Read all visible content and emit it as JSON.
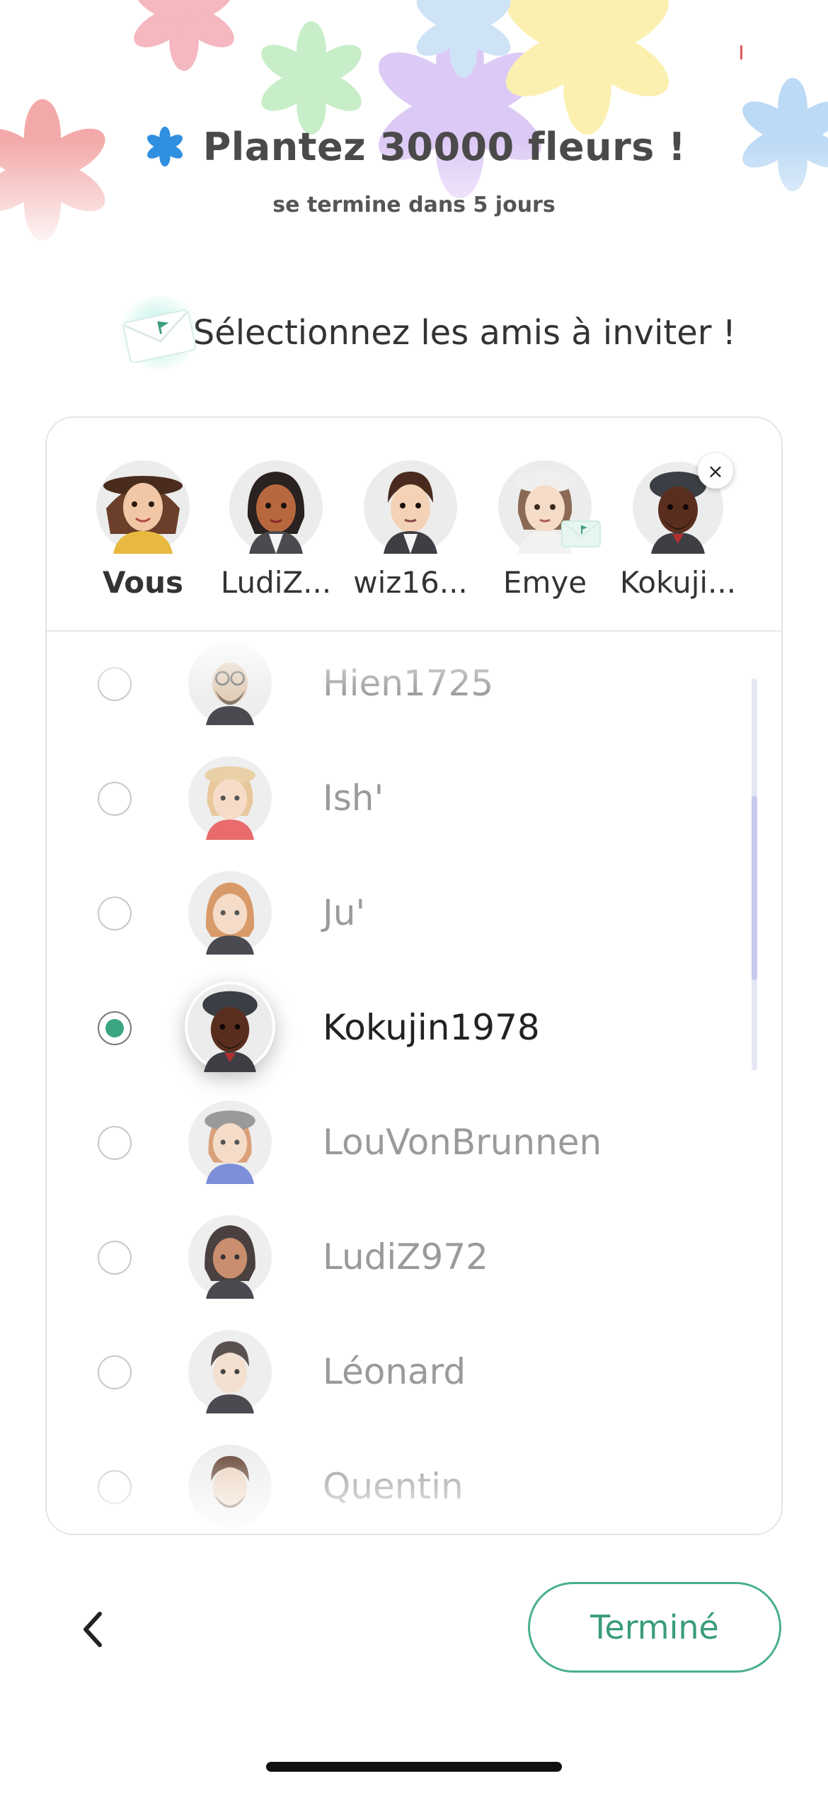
{
  "event": {
    "title": "Plantez 30000 fleurs !",
    "subtitle": "se termine dans 5 jours",
    "icon": "blue-flower-icon"
  },
  "instruction": {
    "text": "Sélectionnez les amis à inviter !",
    "icon": "envelope-icon"
  },
  "selected": [
    {
      "name": "Vous",
      "avatar": "avatar-vous"
    },
    {
      "name": "LudiZ...",
      "avatar": "avatar-ludiz"
    },
    {
      "name": "wiz16...",
      "avatar": "avatar-wiz"
    },
    {
      "name": "Emye",
      "avatar": "avatar-emye",
      "badge": "mail-icon"
    },
    {
      "name": "Kokuji...",
      "avatar": "avatar-kokujin",
      "remove": "×"
    }
  ],
  "friends": [
    {
      "name": "Hien1725",
      "checked": false
    },
    {
      "name": "Ish'",
      "checked": false
    },
    {
      "name": "Ju'",
      "checked": false
    },
    {
      "name": "Kokujin1978",
      "checked": true
    },
    {
      "name": "LouVonBrunnen",
      "checked": false
    },
    {
      "name": "LudiZ972",
      "checked": false
    },
    {
      "name": "Léonard",
      "checked": false
    },
    {
      "name": "Quentin",
      "checked": false
    }
  ],
  "footer": {
    "back_icon": "chevron-left-icon",
    "done_label": "Terminé"
  },
  "colors": {
    "accent_green": "#3aa57e",
    "flower_blue": "#2f8fe0",
    "scrollbar": "#c6c8ec"
  }
}
